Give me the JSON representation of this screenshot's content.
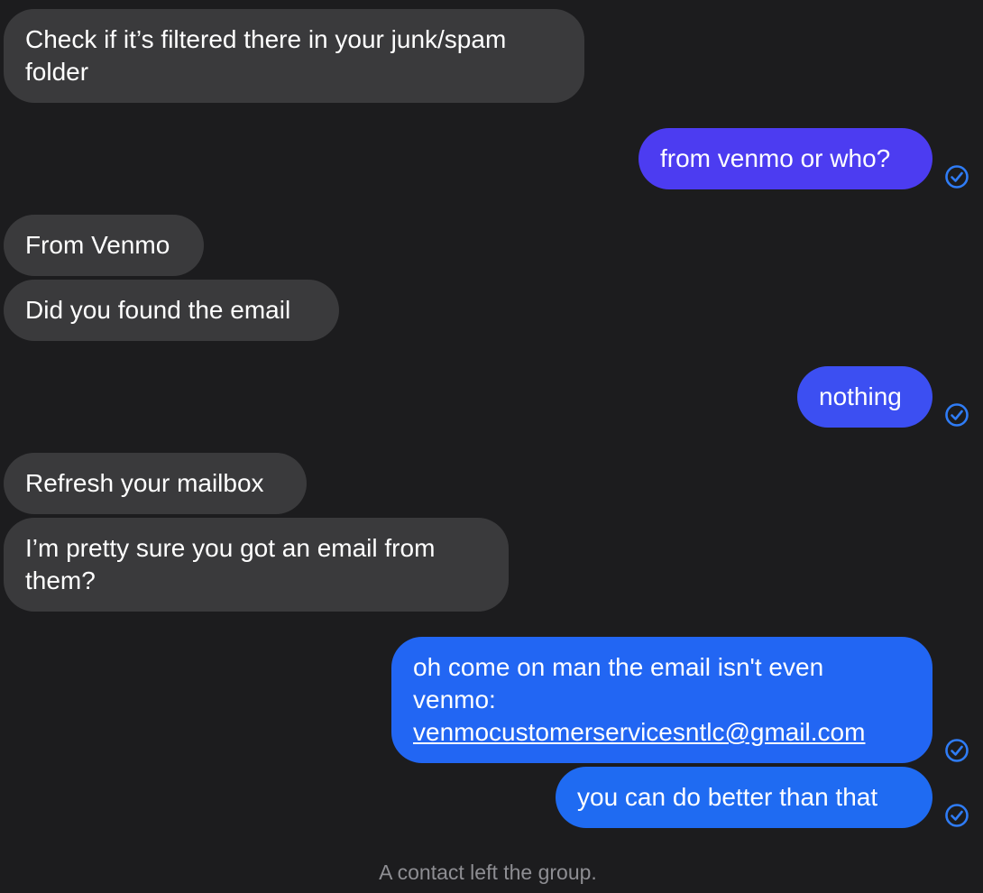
{
  "messages": [
    {
      "direction": "incoming",
      "lines": [
        "Check if it’s filtered there in your junk/spam",
        "folder"
      ]
    },
    {
      "direction": "outgoing",
      "lines": [
        "from venmo or who?"
      ],
      "status_icon": "check-circle-icon"
    },
    {
      "direction": "incoming",
      "lines": [
        "From Venmo"
      ]
    },
    {
      "direction": "incoming",
      "lines": [
        "Did you found the email"
      ]
    },
    {
      "direction": "outgoing",
      "lines": [
        "nothing"
      ],
      "status_icon": "check-circle-icon"
    },
    {
      "direction": "incoming",
      "lines": [
        "Refresh your mailbox"
      ]
    },
    {
      "direction": "incoming",
      "lines": [
        "I’m pretty sure you got an email from",
        "them?"
      ]
    },
    {
      "direction": "outgoing",
      "lines": [
        "oh come on man the email isn't even",
        "venmo:",
        "venmocustomerservicesntlc@gmail.com"
      ],
      "status_icon": "check-circle-icon"
    },
    {
      "direction": "outgoing",
      "lines": [
        "you can do better than that"
      ],
      "status_icon": "check-circle-icon"
    }
  ],
  "system_notice": "A contact left the group.",
  "colors": {
    "background": "#1c1c1e",
    "incoming_bubble": "#3a3a3c",
    "outgoing_bubble_top": "#4f38f0",
    "outgoing_bubble_bottom": "#1f6bf2",
    "check_icon": "#2f7cf6",
    "system_text": "#8e8e93"
  }
}
